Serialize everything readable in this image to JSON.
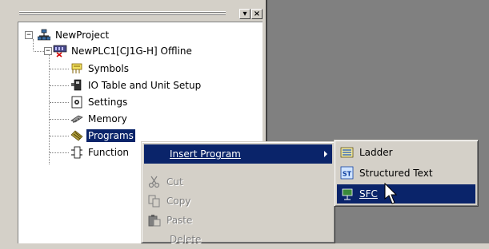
{
  "panel": {
    "tree": [
      {
        "id": "project",
        "label": "NewProject",
        "icon": "project-network-icon",
        "expander": "−"
      },
      {
        "id": "plc",
        "label": "NewPLC1[CJ1G-H] Offline",
        "icon": "plc-offline-icon",
        "expander": "−"
      },
      {
        "id": "symbols",
        "label": "Symbols",
        "icon": "symbols-icon"
      },
      {
        "id": "io",
        "label": "IO Table and Unit Setup",
        "icon": "io-table-icon"
      },
      {
        "id": "settings",
        "label": "Settings",
        "icon": "settings-icon"
      },
      {
        "id": "memory",
        "label": "Memory",
        "icon": "memory-icon"
      },
      {
        "id": "programs",
        "label": "Programs",
        "icon": "programs-icon",
        "selected": true
      },
      {
        "id": "functions",
        "label": "Function",
        "icon": "function-blocks-icon"
      }
    ]
  },
  "context_menu": {
    "items": [
      {
        "label": "Insert Program",
        "mnemonic": "I",
        "highlighted": true,
        "has_submenu": true
      },
      {
        "label": "Cut",
        "icon": "scissors-icon",
        "disabled": true
      },
      {
        "label": "Copy",
        "icon": "copy-icon",
        "disabled": true
      },
      {
        "label": "Paste",
        "icon": "paste-icon",
        "disabled": true
      },
      {
        "label": "Delete",
        "disabled": true
      }
    ]
  },
  "submenu": {
    "items": [
      {
        "label": "Ladder",
        "icon": "ladder-icon"
      },
      {
        "label": "Structured Text",
        "icon": "structured-text-icon"
      },
      {
        "label": "SFC",
        "icon": "sfc-icon",
        "highlighted": true
      }
    ]
  },
  "colors": {
    "panel": "#d4d0c8",
    "workspace": "#808080",
    "selection": "#0a246a",
    "tree_background": "#ffffff"
  }
}
